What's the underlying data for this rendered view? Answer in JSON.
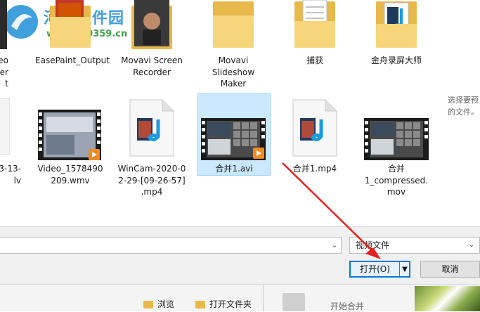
{
  "watermark": {
    "title": "河东软件园",
    "url": "www.pc0359.cn"
  },
  "files_row1": [
    {
      "label": "eo\nter\nt",
      "kind": "thumb-dark"
    },
    {
      "label": "EasePaint_Output",
      "kind": "folder"
    },
    {
      "label": "Movavi Screen\nRecorder",
      "kind": "folder-photo"
    },
    {
      "label": "Movavi\nSlideshow\nMaker",
      "kind": "folder"
    },
    {
      "label": "捕获",
      "kind": "folder-doc"
    },
    {
      "label": "金舟录屏大师",
      "kind": "folder-media"
    }
  ],
  "files_row2": [
    {
      "label": "3-13-\nlv",
      "kind": "doc"
    },
    {
      "label": "Video_1578490\n209.wmv",
      "kind": "video-thumb"
    },
    {
      "label": "WinCam-2020-0\n2-29-[09-26-57]\n.mp4",
      "kind": "media-doc"
    },
    {
      "label": "合并1.avi",
      "kind": "video-thumb-selected"
    },
    {
      "label": "合并1.mp4",
      "kind": "media-doc"
    },
    {
      "label": "合并\n1_compressed.\nmov",
      "kind": "video-thumb"
    }
  ],
  "preview_hint": "选择要预\n的文件。",
  "dialog": {
    "filename_value": "",
    "filetype_selected": "视频文件",
    "open_label": "打开(O)",
    "cancel_label": "取消"
  },
  "app_strip": {
    "browse_label": "浏览",
    "open_folder_label": "打开文件夹",
    "start_merge_label": "开始合并"
  },
  "colors": {
    "accent": "#0078d7",
    "selection": "#cce8ff",
    "arrow": "#e8201f"
  }
}
